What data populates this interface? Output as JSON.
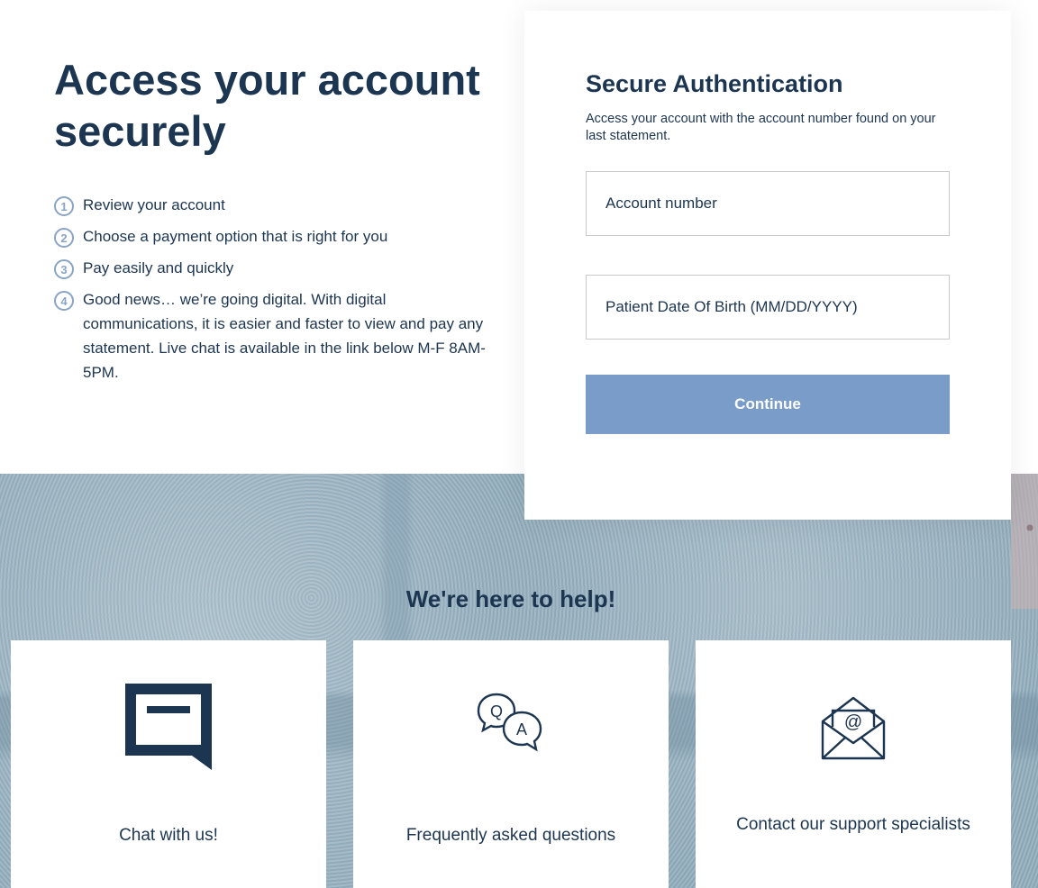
{
  "hero": {
    "title": "Access your account securely"
  },
  "steps": [
    {
      "number": "1",
      "text": "Review your account"
    },
    {
      "number": "2",
      "text": "Choose a payment option that is right for you"
    },
    {
      "number": "3",
      "text": "Pay easily and quickly"
    },
    {
      "number": "4",
      "text": "Good news… we’re going digital. With digital communications, it is easier and faster to view and pay any statement. Live chat is available in the link below M-F 8AM-5PM."
    }
  ],
  "auth": {
    "title": "Secure Authentication",
    "description": "Access your account with the account number found on your last statement.",
    "account_placeholder": "Account number",
    "dob_placeholder": "Patient Date Of Birth (MM/DD/YYYY)",
    "continue_label": "Continue"
  },
  "help": {
    "title": "We're here to help!",
    "cards": [
      {
        "label": "Chat with us!",
        "icon": "chat-icon"
      },
      {
        "label": "Frequently asked questions",
        "icon": "qa-icon"
      },
      {
        "label": "Contact our support specialists",
        "icon": "email-icon"
      }
    ]
  },
  "colors": {
    "primary_text": "#1c3550",
    "button": "#7a9cc8",
    "step_circle": "#8aa4c6"
  }
}
